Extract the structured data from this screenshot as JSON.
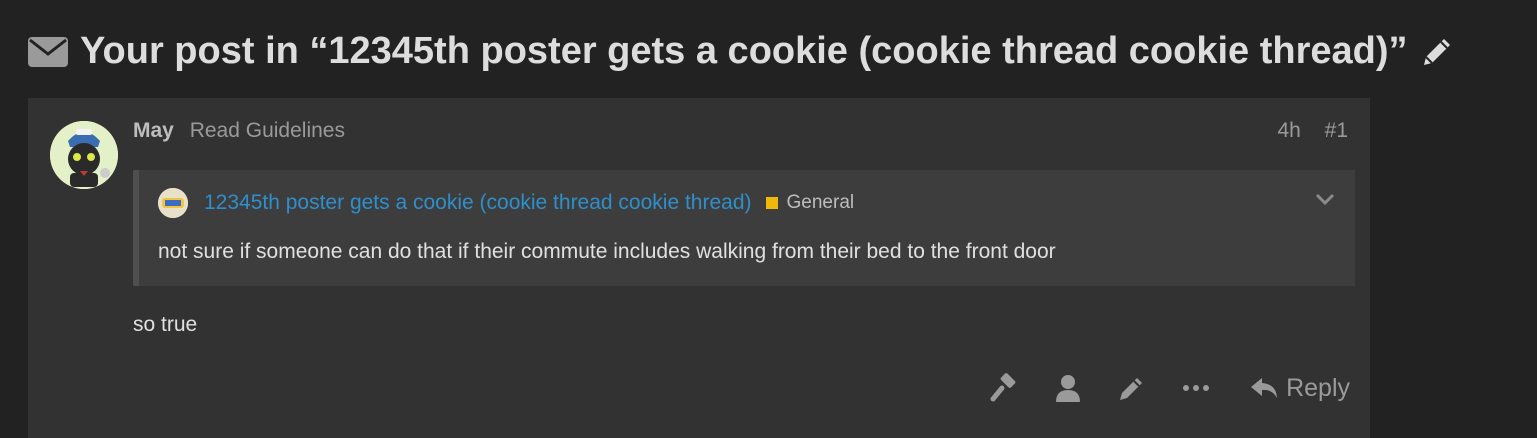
{
  "topic": {
    "title": "Your post in “12345th poster gets a cookie (cookie thread cookie thread)”",
    "icons": {
      "prefix": "envelope-icon",
      "suffix": "pencil-icon"
    }
  },
  "post": {
    "username": "May",
    "user_title": "Read Guidelines",
    "age": "4h",
    "number": "#1",
    "quote": {
      "topic_link": "12345th poster gets a cookie (cookie thread cookie thread)",
      "category": "General",
      "category_color": "#f1b80c",
      "text": "not sure if someone can do that if their commute includes walking from their bed to the front door"
    },
    "body": "so true",
    "actions": {
      "icons": [
        "gavel-icon",
        "user-icon",
        "pencil-icon",
        "ellipsis-icon"
      ],
      "reply_label": "Reply"
    }
  },
  "colors": {
    "background": "#222222",
    "post_bg": "#323232",
    "quote_bg": "#3d3d3d",
    "link": "#2e8fcb",
    "muted": "#9a9a9a"
  }
}
